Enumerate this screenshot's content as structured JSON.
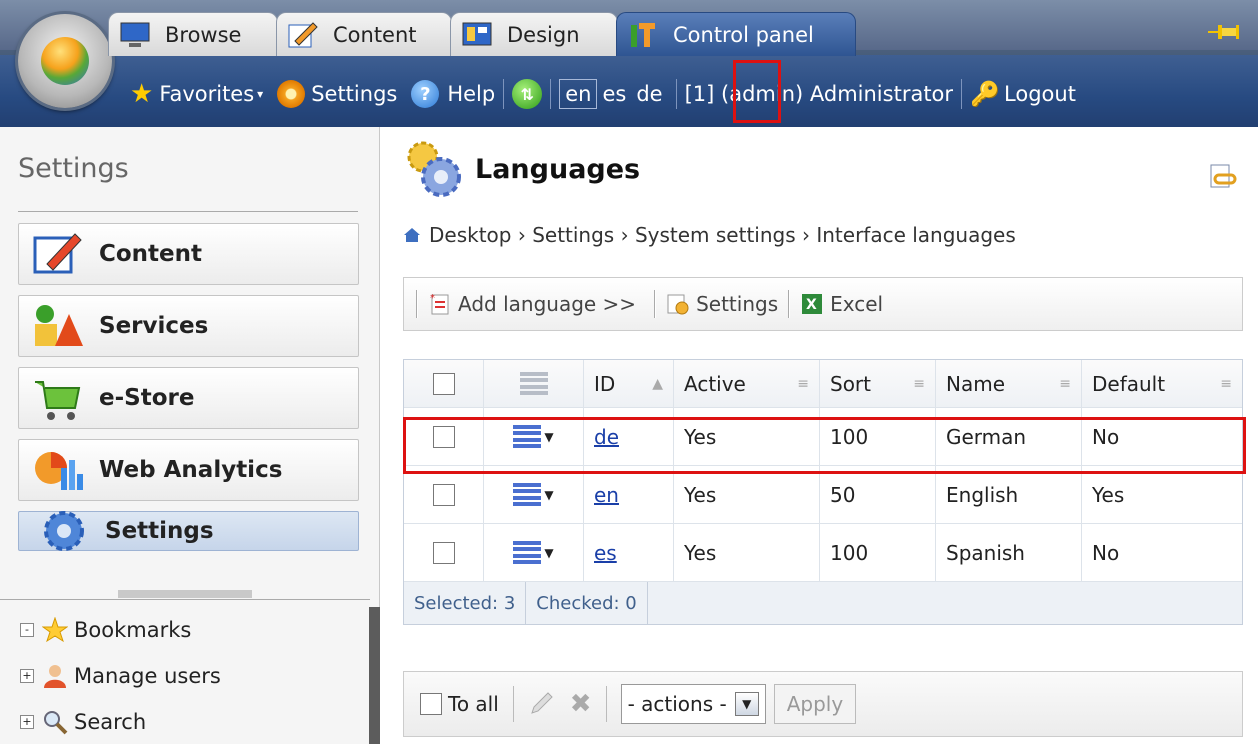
{
  "tabs": [
    {
      "label": "Browse"
    },
    {
      "label": "Content"
    },
    {
      "label": "Design"
    },
    {
      "label": "Control panel"
    }
  ],
  "nav": {
    "favorites": "Favorites",
    "settings": "Settings",
    "help": "Help",
    "langs": [
      "en",
      "es",
      "de"
    ],
    "user": "[1] (admin) Administrator",
    "logout": "Logout"
  },
  "left": {
    "title": "Settings",
    "buttons": [
      {
        "label": "Content"
      },
      {
        "label": "Services"
      },
      {
        "label": "e-Store"
      },
      {
        "label": "Web Analytics"
      },
      {
        "label": "Settings"
      }
    ],
    "tree": [
      {
        "label": "Bookmarks",
        "pm": "-"
      },
      {
        "label": "Manage users",
        "pm": "+"
      },
      {
        "label": "Search",
        "pm": "+"
      }
    ]
  },
  "page": {
    "title": "Languages",
    "breadcrumb": "Desktop › Settings › System settings › Interface languages"
  },
  "toolbar": {
    "add": "Add language >>",
    "settings": "Settings",
    "excel": "Excel"
  },
  "grid": {
    "headers": {
      "id": "ID",
      "active": "Active",
      "sort": "Sort",
      "name": "Name",
      "default": "Default"
    },
    "rows": [
      {
        "id": "de",
        "active": "Yes",
        "sort": "100",
        "name": "German",
        "default": "No"
      },
      {
        "id": "en",
        "active": "Yes",
        "sort": "50",
        "name": "English",
        "default": "Yes"
      },
      {
        "id": "es",
        "active": "Yes",
        "sort": "100",
        "name": "Spanish",
        "default": "No"
      }
    ],
    "selected": "Selected: 3",
    "checked": "Checked: 0"
  },
  "bottom": {
    "toall": "To all",
    "actions": "- actions -",
    "apply": "Apply"
  }
}
